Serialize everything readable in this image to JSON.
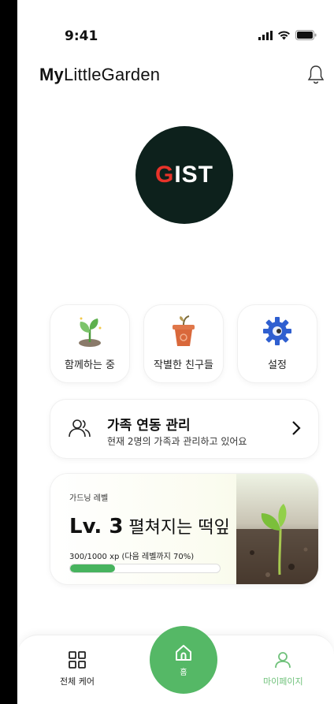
{
  "status_bar": {
    "time": "9:41"
  },
  "header": {
    "logo_bold": "My",
    "logo_rest": "LittleGarden"
  },
  "profile": {
    "avatar_text_accent": "G",
    "avatar_text_rest": "IST"
  },
  "quick_actions": [
    {
      "label": "함께하는 중",
      "icon": "sprout-icon"
    },
    {
      "label": "작별한 친구들",
      "icon": "flower-pot-icon"
    },
    {
      "label": "설정",
      "icon": "gear-icon"
    }
  ],
  "family": {
    "title": "가족 연동 관리",
    "subtitle": "현재 2명의 가족과 관리하고 있어요"
  },
  "level": {
    "label": "가드닝 레벨",
    "level": "Lv. 3",
    "name": "펼쳐지는 떡잎",
    "xp_text": "300/1000 xp (다음 레벨까지 70%)",
    "progress": 0.3
  },
  "tabbar": {
    "all_care": "전체 케어",
    "home": "홈",
    "my_page": "마이페이지"
  },
  "colors": {
    "accent": "#55b866",
    "avatar_bg": "#0d211c",
    "brand_red": "#e8332a"
  }
}
